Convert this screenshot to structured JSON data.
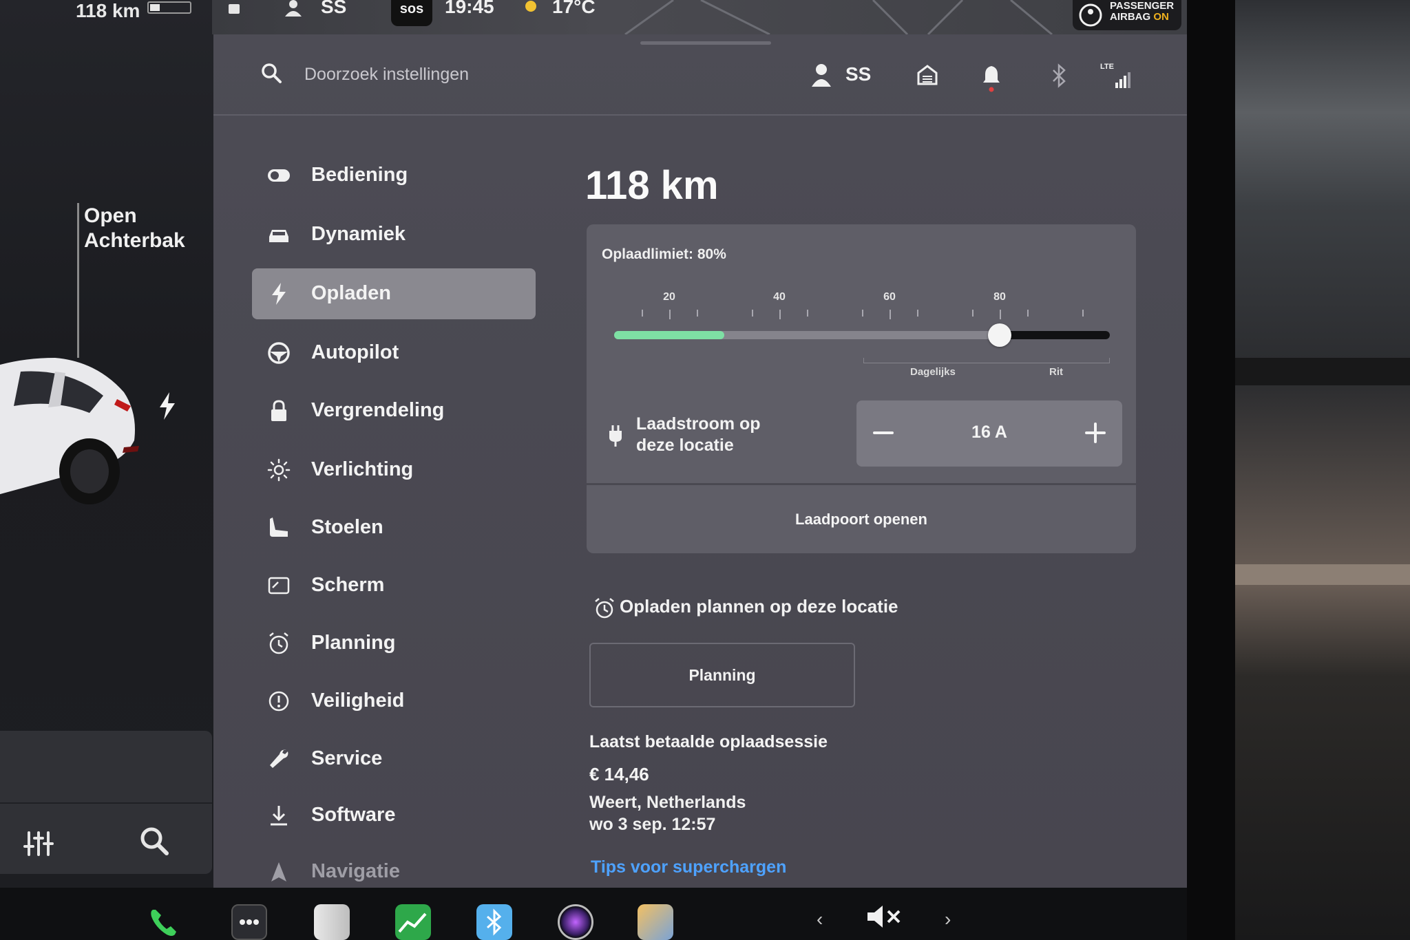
{
  "status_bar": {
    "range": "118 km",
    "user": "SS",
    "sos": "sos",
    "time": "19:45",
    "temperature": "17°C",
    "airbag_line1": "PASSENGER",
    "airbag_line2": "AIRBAG",
    "airbag_state": "ON"
  },
  "left_panel": {
    "trunk_line1": "Open",
    "trunk_line2": "Achterbak"
  },
  "header": {
    "search_placeholder": "Doorzoek instellingen",
    "user_label": "SS",
    "signal_label": "LTE"
  },
  "nav": {
    "items": [
      {
        "label": "Bediening",
        "icon": "toggle-icon"
      },
      {
        "label": "Dynamiek",
        "icon": "car-icon"
      },
      {
        "label": "Opladen",
        "icon": "bolt-icon",
        "active": true
      },
      {
        "label": "Autopilot",
        "icon": "steering-wheel-icon"
      },
      {
        "label": "Vergrendeling",
        "icon": "lock-icon"
      },
      {
        "label": "Verlichting",
        "icon": "sun-icon"
      },
      {
        "label": "Stoelen",
        "icon": "seat-icon"
      },
      {
        "label": "Scherm",
        "icon": "display-icon"
      },
      {
        "label": "Planning",
        "icon": "alarm-clock-icon"
      },
      {
        "label": "Veiligheid",
        "icon": "alert-circle-icon"
      },
      {
        "label": "Service",
        "icon": "wrench-icon"
      },
      {
        "label": "Software",
        "icon": "download-icon"
      },
      {
        "label": "Navigatie",
        "icon": "navigation-arrow-icon"
      }
    ]
  },
  "charging": {
    "range": "118 km",
    "limit_label": "Oplaadlimiet: 80%",
    "limit_value": 80,
    "current_charge": 30,
    "slider_ticks": [
      "20",
      "40",
      "60",
      "80"
    ],
    "zone_daily": "Dagelijks",
    "zone_trip": "Rit",
    "current_label_line1": "Laadstroom op",
    "current_label_line2": "deze locatie",
    "current_value": "16 A",
    "open_port_label": "Laadpoort openen",
    "schedule_title": "Opladen plannen op deze locatie",
    "planning_button": "Planning",
    "last_session_title": "Laatst betaalde oplaadsessie",
    "last_session_amount": "€ 14,46",
    "last_session_location": "Weert, Netherlands",
    "last_session_date": "wo 3 sep. 12:57",
    "tips_link": "Tips voor superchargen"
  },
  "colors": {
    "charge_green": "#7ee0a4",
    "link_blue": "#4ea2ff",
    "airbag_on": "#f0b21e",
    "active_nav": "#8a8990"
  }
}
